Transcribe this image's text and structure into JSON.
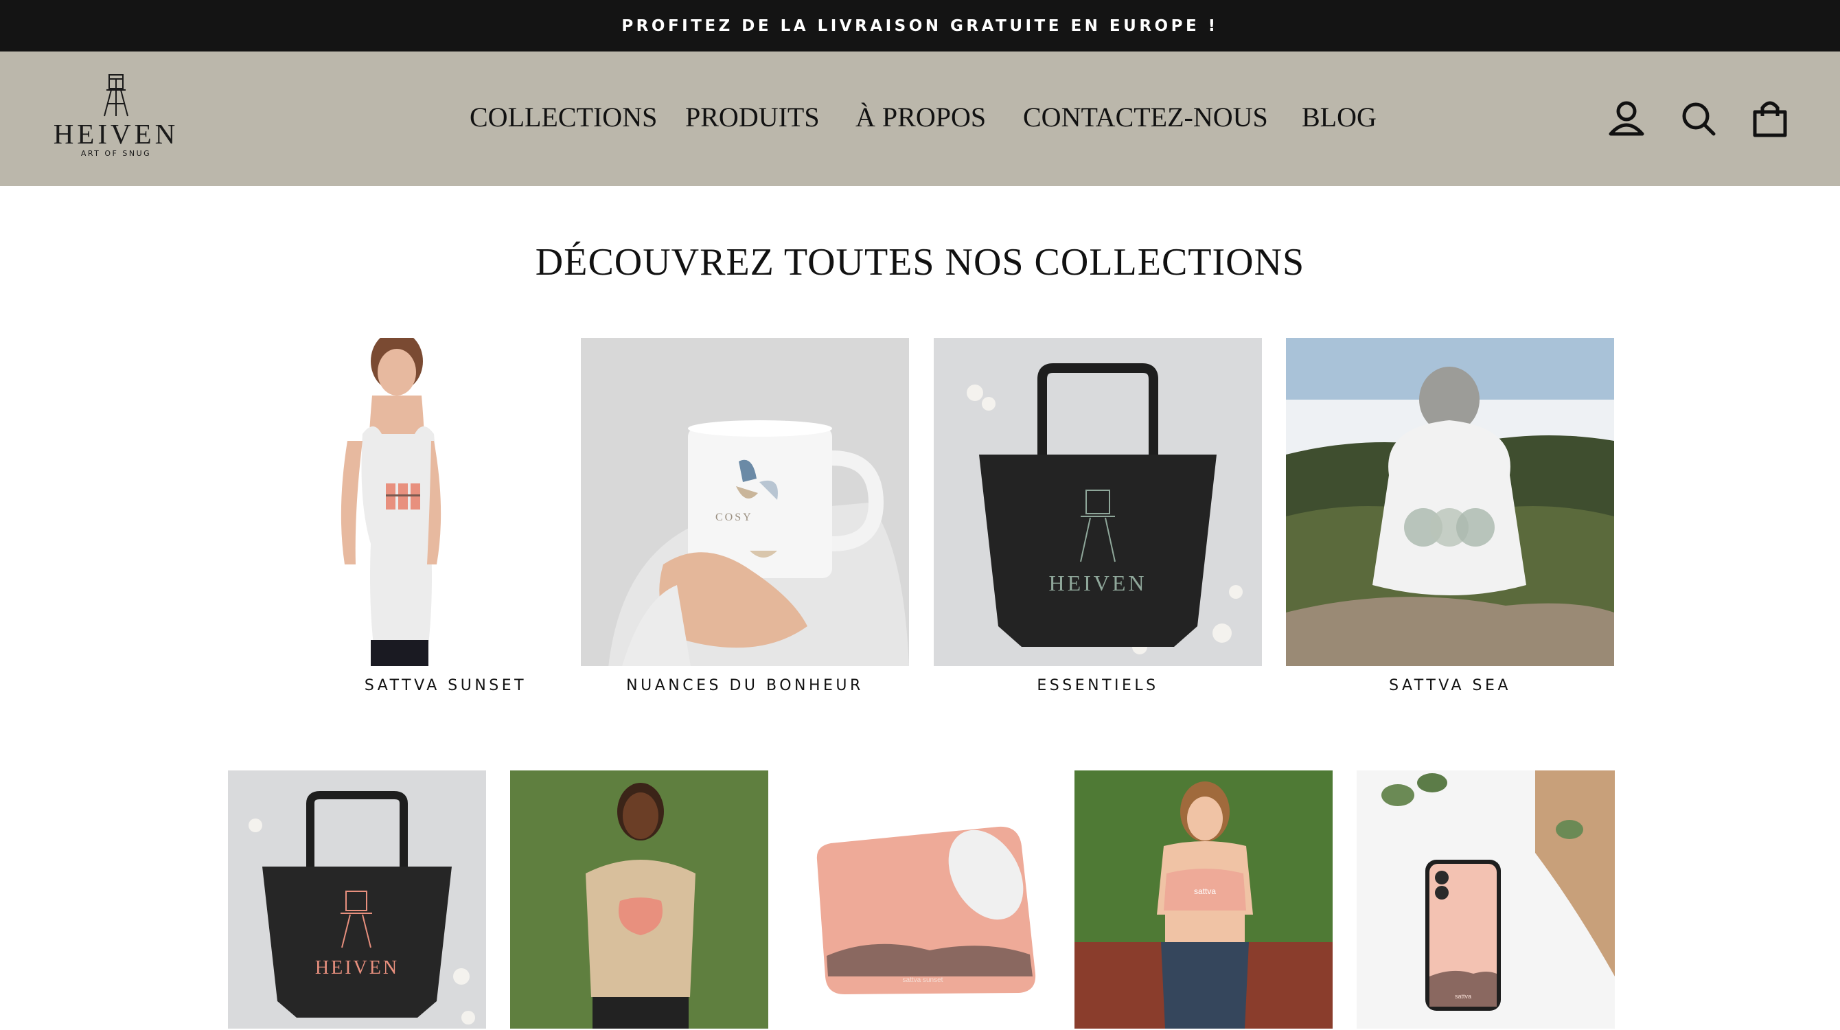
{
  "announcement": "PROFITEZ DE LA LIVRAISON GRATUITE EN EUROPE !",
  "brand": {
    "name": "HEIVEN",
    "tagline": "ART OF SNUG"
  },
  "nav": [
    "COLLECTIONS",
    "PRODUITS",
    "À PROPOS",
    "CONTACTEZ-NOUS",
    "BLOG"
  ],
  "header_icons": [
    "user-icon",
    "search-icon",
    "cart-icon"
  ],
  "colors": {
    "announcement_bg": "#141414",
    "header_bg": "#bbb7ab",
    "salmon": "#e8907e"
  },
  "section_title": "DÉCOUVREZ TOUTES NOS COLLECTIONS",
  "collections": [
    {
      "label": "SATTVA SUNSET"
    },
    {
      "label": "NUANCES DU BONHEUR",
      "mug_text": "COSY"
    },
    {
      "label": "ESSENTIELS",
      "bag_text": "HEIVEN"
    },
    {
      "label": "SATTVA SEA"
    }
  ],
  "products": [
    {
      "bag_text": "HEIVEN"
    },
    {},
    {
      "mousepad_text": "sattva sunset"
    },
    {
      "bra_text": "sattva"
    },
    {
      "phone_text": "sattva"
    }
  ]
}
